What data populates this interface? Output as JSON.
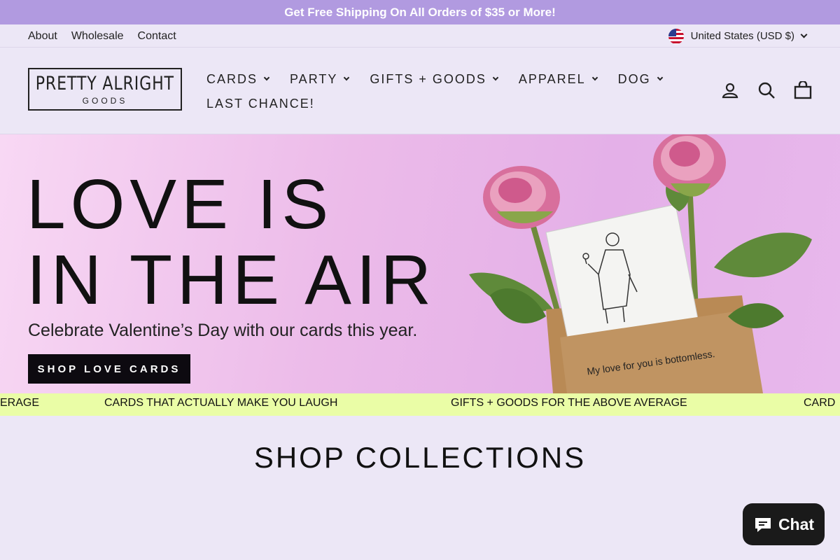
{
  "announcement": "Get Free Shipping On All Orders of $35 or More!",
  "utility": {
    "links": [
      "About",
      "Wholesale",
      "Contact"
    ],
    "currency": "United States (USD $)"
  },
  "logo": {
    "line1": "PRETTY ALRIGHT",
    "line2": "GOODS"
  },
  "nav": {
    "row1": [
      "CARDS",
      "PARTY",
      "GIFTS + GOODS",
      "APPAREL",
      "DOG"
    ],
    "row2": "LAST CHANCE!"
  },
  "header_icons": [
    "account-icon",
    "search-icon",
    "cart-icon"
  ],
  "hero": {
    "line1": "LOVE IS",
    "line2": "IN THE AIR",
    "subtitle": "Celebrate Valentine’s Day with our cards this year.",
    "cta": "SHOP LOVE CARDS",
    "card_caption": "My love for you is bottomless."
  },
  "marquee": {
    "items": [
      "ERAGE",
      "CARDS THAT ACTUALLY MAKE YOU LAUGH",
      "GIFTS + GOODS FOR THE ABOVE AVERAGE",
      "CARD"
    ]
  },
  "collections_title": "SHOP COLLECTIONS",
  "chat_label": "Chat",
  "colors": {
    "announcement_bg": "#b19ae0",
    "page_bg": "#ece7f6",
    "marquee_bg": "#eafda6",
    "cta_bg": "#0d0a10"
  }
}
